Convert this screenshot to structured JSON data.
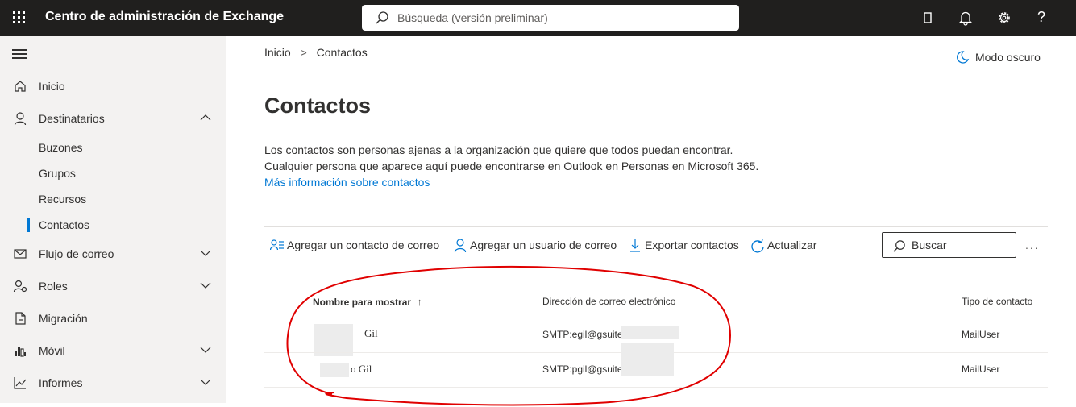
{
  "topbar": {
    "app_title": "Centro de administración de Exchange",
    "search_placeholder": "Búsqueda (versión preliminar)",
    "icons": [
      "waffle-icon",
      "search-icon",
      "device-icon",
      "bell-icon",
      "gear-icon",
      "help-icon"
    ],
    "help_label": "?"
  },
  "sidebar": {
    "items": [
      {
        "label": "Inicio",
        "icon": "home-icon"
      },
      {
        "label": "Destinatarios",
        "icon": "person-icon",
        "expanded": true
      },
      {
        "label": "Buzones"
      },
      {
        "label": "Grupos"
      },
      {
        "label": "Recursos"
      },
      {
        "label": "Contactos",
        "selected": true
      },
      {
        "label": "Flujo de correo",
        "icon": "mail-icon"
      },
      {
        "label": "Roles",
        "icon": "roles-icon"
      },
      {
        "label": "Migración",
        "icon": "migration-icon"
      },
      {
        "label": "Móvil",
        "icon": "mobile-icon"
      },
      {
        "label": "Informes",
        "icon": "reports-icon"
      }
    ]
  },
  "breadcrumb": {
    "home": "Inicio",
    "separator": ">",
    "current": "Contactos"
  },
  "dark_mode_label": "Modo oscuro",
  "page": {
    "title": "Contactos",
    "description_line1": "Los contactos son personas ajenas a la organización que quiere que todos puedan encontrar.",
    "description_line2": "Cualquier persona que aparece aquí puede encontrarse en Outlook en Personas en Microsoft 365.",
    "learn_more": "Más información sobre contactos"
  },
  "commands": {
    "add_mail_contact": "Agregar un contacto de correo",
    "add_mail_user": "Agregar un usuario de correo",
    "export": "Exportar contactos",
    "refresh": "Actualizar",
    "search_placeholder": "Buscar",
    "more": "..."
  },
  "table": {
    "columns": [
      "Nombre para mostrar",
      "Dirección de correo electrónico",
      "Tipo de contacto"
    ],
    "sort_indicator": "↑",
    "rows": [
      {
        "name": "Gil",
        "email": "SMTP:egil@gsuite",
        "type": "MailUser"
      },
      {
        "name": "o Gil",
        "email": "SMTP:pgil@gsuite",
        "type": "MailUser"
      }
    ]
  },
  "colors": {
    "topbar_bg": "#201f1e",
    "sidebar_bg": "#f3f2f1",
    "accent": "#0078d4",
    "annotation": "#e00000"
  }
}
